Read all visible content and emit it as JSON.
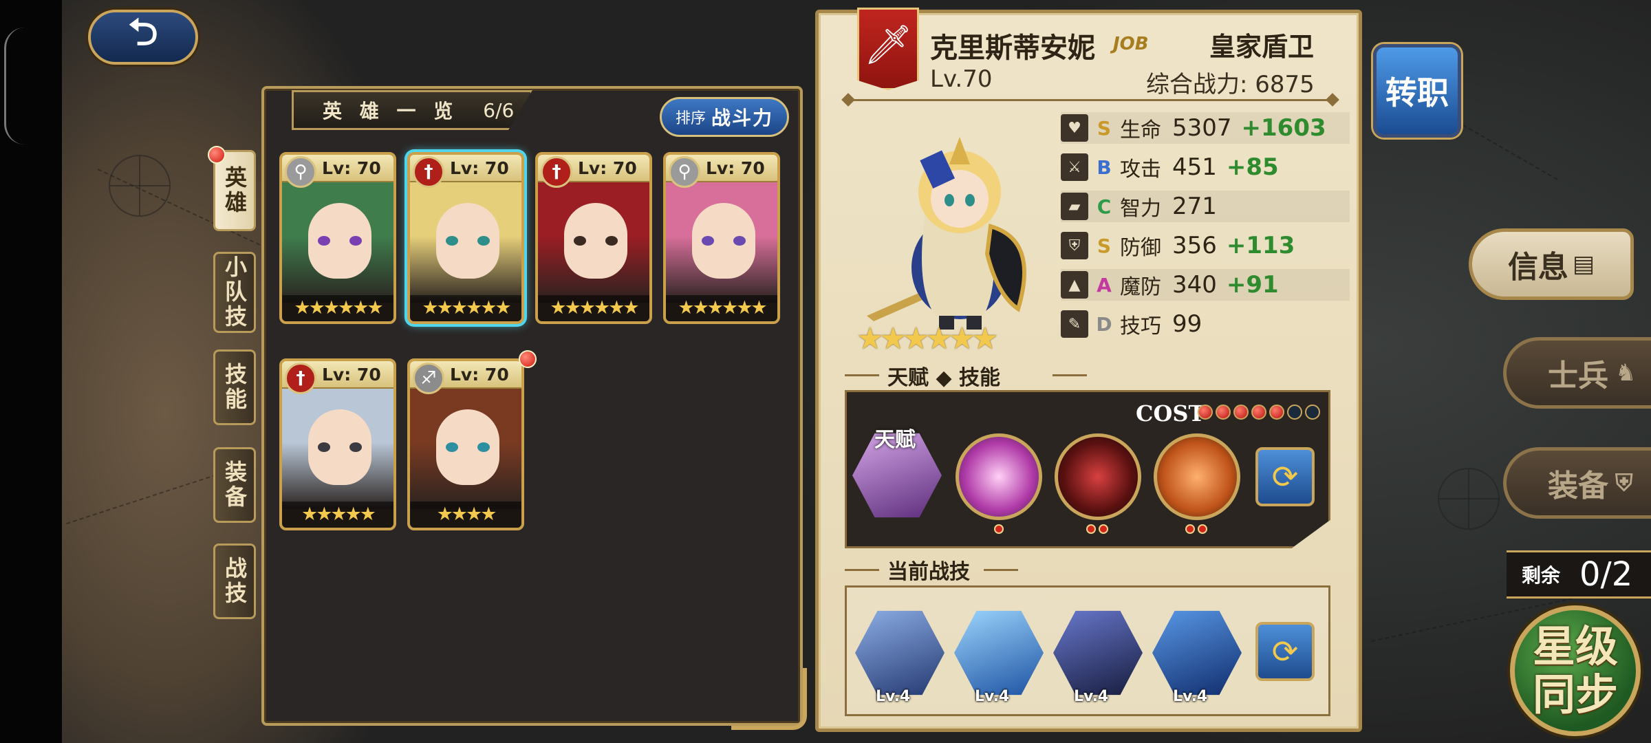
{
  "back_button": {
    "icon": "back-arrow-icon"
  },
  "hero_list": {
    "title": "英 雄 一 览",
    "count": "6/6",
    "sort": {
      "prefix": "排序",
      "label": "战斗力"
    },
    "heroes": [
      {
        "level": "Lv: 70",
        "class_icon": "magnifier-icon",
        "class_color": "#9a9a9a",
        "stars": "★★★★★★",
        "hair": "#3f7d4d",
        "eyes": "#7a3fb0",
        "selected": false
      },
      {
        "level": "Lv: 70",
        "class_icon": "sword-icon",
        "class_color": "#b01f1a",
        "stars": "★★★★★★",
        "hair": "#e6cf7a",
        "eyes": "#2e8f8a",
        "selected": true
      },
      {
        "level": "Lv: 70",
        "class_icon": "sword-icon",
        "class_color": "#b01f1a",
        "stars": "★★★★★★",
        "hair": "#9b1e24",
        "eyes": "#3a2a22",
        "selected": false
      },
      {
        "level": "Lv: 70",
        "class_icon": "magnifier-icon",
        "class_color": "#9a9a9a",
        "stars": "★★★★★★",
        "hair": "#d86f9a",
        "eyes": "#6a4ab0",
        "selected": false
      },
      {
        "level": "Lv: 70",
        "class_icon": "sword-icon",
        "class_color": "#b01f1a",
        "stars": "★★★★★",
        "hair": "#b9c6d6",
        "eyes": "#3a3a40",
        "selected": false
      },
      {
        "level": "Lv: 70",
        "class_icon": "bow-icon",
        "class_color": "#8c8c8c",
        "stars": "★★★★",
        "hair": "#7a3a22",
        "eyes": "#2e8fa0",
        "selected": false
      }
    ]
  },
  "side_tabs": [
    {
      "label": "英雄",
      "active": true
    },
    {
      "label": "小队技",
      "active": false
    },
    {
      "label": "技能",
      "active": false
    },
    {
      "label": "装备",
      "active": false
    },
    {
      "label": "战技",
      "active": false
    }
  ],
  "detail": {
    "name": "克里斯蒂安妮",
    "job_mark": "JOB",
    "job_title": "皇家盾卫",
    "level": "Lv.70",
    "power_label": "综合战力: 6875",
    "stars": "★★★★★★",
    "stats": [
      {
        "icon": "heart-icon",
        "grade": "S",
        "grade_color": "#c99a2a",
        "label": "生命",
        "value": "5307",
        "bonus": "+1603"
      },
      {
        "icon": "sword-icon",
        "grade": "B",
        "grade_color": "#3a6fd0",
        "label": "攻击",
        "value": "451",
        "bonus": "+85"
      },
      {
        "icon": "book-icon",
        "grade": "C",
        "grade_color": "#2e9a4a",
        "label": "智力",
        "value": "271",
        "bonus": ""
      },
      {
        "icon": "shield-icon",
        "grade": "S",
        "grade_color": "#c99a2a",
        "label": "防御",
        "value": "356",
        "bonus": "+113"
      },
      {
        "icon": "wizard-hat-icon",
        "grade": "A",
        "grade_color": "#c23aa0",
        "label": "魔防",
        "value": "340",
        "bonus": "+91"
      },
      {
        "icon": "feather-icon",
        "grade": "D",
        "grade_color": "#8a8a8a",
        "label": "技巧",
        "value": "99",
        "bonus": ""
      }
    ],
    "talent_section_title": "天赋 ◆ 技能",
    "talent_label": "天赋",
    "cost_label": "COST",
    "cost_filled": 5,
    "cost_total": 7,
    "skill_cost_dots": [
      1,
      2,
      2
    ],
    "battle_section_title": "当前战技",
    "battle_skills": [
      {
        "level": "Lv.4"
      },
      {
        "level": "Lv.4"
      },
      {
        "level": "Lv.4"
      },
      {
        "level": "Lv.4"
      }
    ]
  },
  "right_panel": {
    "job_change": "转职",
    "info": "信息",
    "soldier": "士兵",
    "equipment": "装备",
    "remain_label": "剩余",
    "remain_value": "0/2",
    "star_sync_line1": "星级",
    "star_sync_line2": "同步"
  }
}
